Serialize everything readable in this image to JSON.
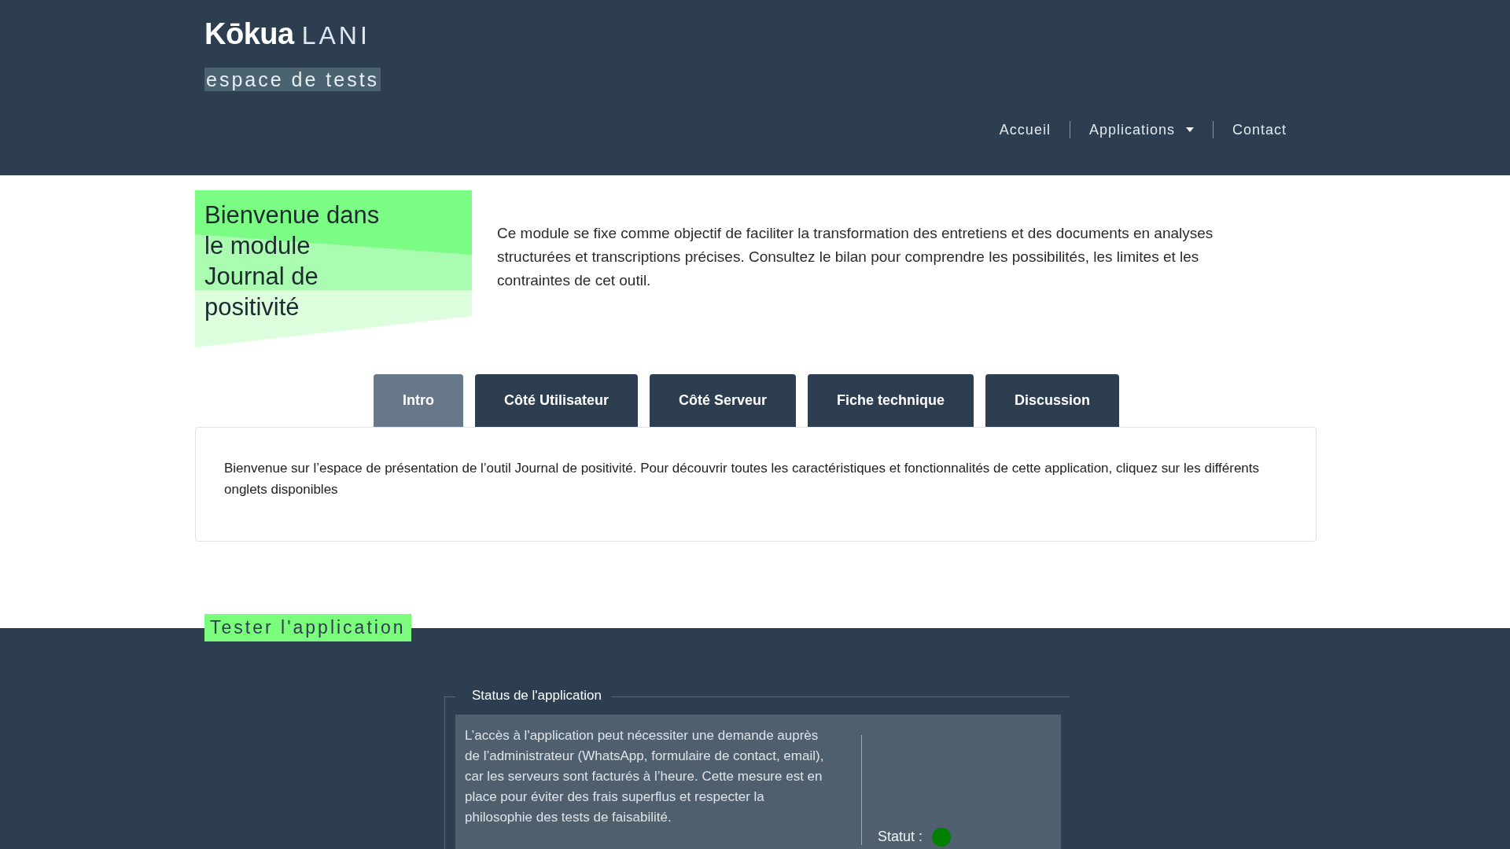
{
  "header": {
    "logo_bold": "Kōkua",
    "logo_light": "LANI",
    "tagline": "espace de tests",
    "nav": [
      {
        "label": "Accueil",
        "dropdown": false
      },
      {
        "label": "Applications",
        "dropdown": true
      },
      {
        "label": "Contact",
        "dropdown": false
      }
    ]
  },
  "hero": {
    "title": "Bienvenue dans le module Journal de positivité",
    "description": "Ce module se fixe comme objectif de faciliter la transformation des entretiens et des documents en analyses structurées et transcriptions précises. Consultez le bilan pour comprendre les possibilités, les limites et les contraintes de cet outil."
  },
  "tabs": [
    {
      "label": "Intro",
      "selected": true
    },
    {
      "label": "Côté Utilisateur",
      "selected": false
    },
    {
      "label": "Côté Serveur",
      "selected": false
    },
    {
      "label": "Fiche technique",
      "selected": false
    },
    {
      "label": "Discussion",
      "selected": false
    }
  ],
  "tab_content": "Bienvenue sur l’espace de présentation de l’outil Journal de positivité. Pour découvrir toutes les caractéristiques et fonctionnalités de cette application, cliquez sur les différents onglets disponibles",
  "test_section": {
    "heading": "Tester l'application",
    "legend": "Status de l'application",
    "notice": "L’accès à l'application peut nécessiter une demande auprès de l’administrateur (WhatsApp, formulaire de contact, email), car les serveurs sont facturés à l’heure. Cette mesure est en place pour éviter des frais superflus et respecter la philosophie des tests de faisabilité.",
    "status": {
      "label": "Statut :",
      "color": "#008000"
    }
  }
}
